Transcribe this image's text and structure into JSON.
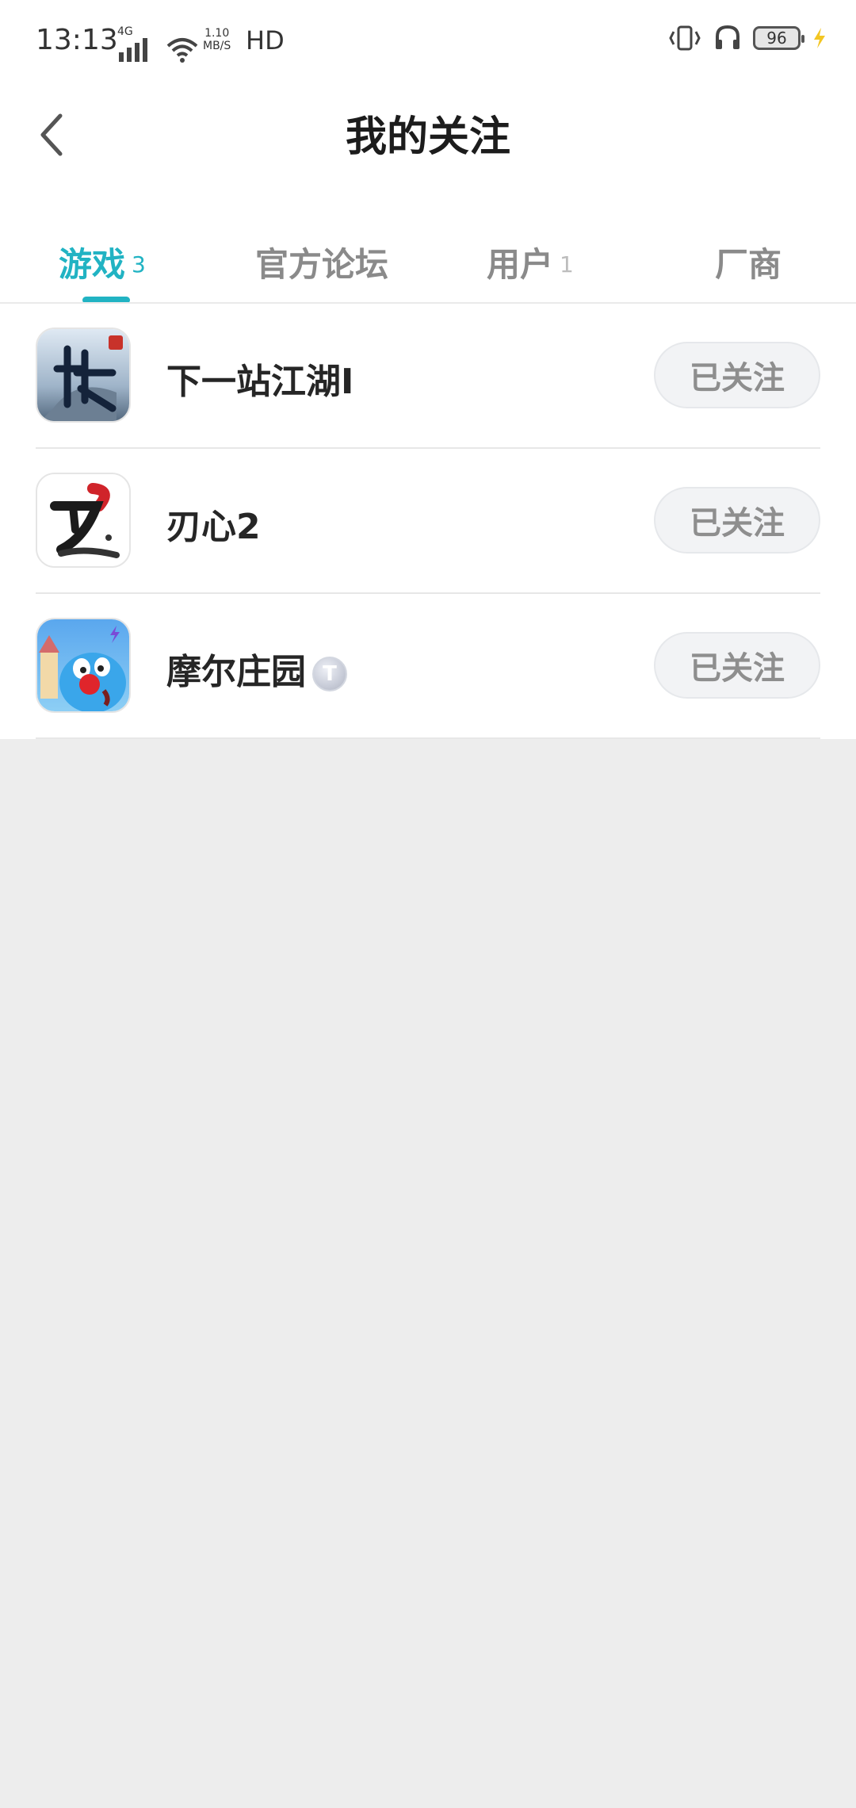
{
  "status_bar": {
    "time": "13:13",
    "network": "4G",
    "speed_value": "1.10",
    "speed_unit": "MB/S",
    "hd": "HD",
    "battery": "96"
  },
  "header": {
    "title": "我的关注"
  },
  "tabs": [
    {
      "label": "游戏",
      "count": "3",
      "active": true
    },
    {
      "label": "官方论坛",
      "count": "",
      "active": false
    },
    {
      "label": "用户",
      "count": "1",
      "active": false
    },
    {
      "label": "厂商",
      "count": "",
      "active": false
    }
  ],
  "items": [
    {
      "name": "下一站江湖Ⅰ",
      "button": "已关注",
      "icon": "xia-game-icon"
    },
    {
      "name": "刃心2",
      "button": "已关注",
      "icon": "ren-game-icon"
    },
    {
      "name": "摩尔庄园",
      "badge": "T",
      "button": "已关注",
      "icon": "mole-game-icon"
    }
  ],
  "colors": {
    "accent": "#21b3c3",
    "background": "#ededed"
  }
}
